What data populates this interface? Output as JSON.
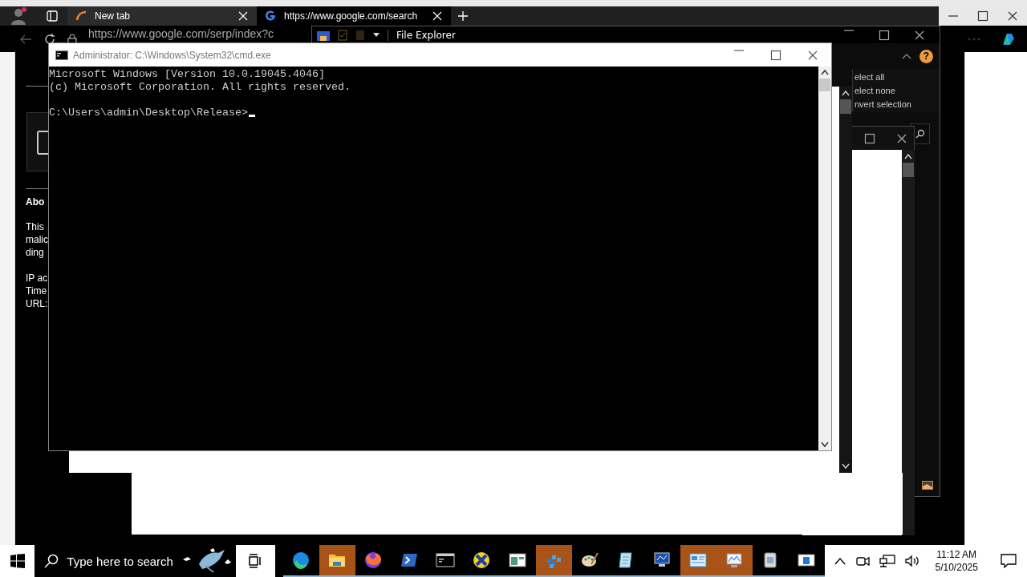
{
  "browser": {
    "tabs": [
      {
        "label": "New tab",
        "selected": false
      },
      {
        "label": "https://www.google.com/search",
        "selected": true
      }
    ],
    "address": "https://www.google.com/serp/index?c",
    "page_heading": "Abo",
    "page_paragraph": [
      "This",
      "malic",
      "ding"
    ],
    "page_details": [
      "IP ac",
      "Time",
      "URL:"
    ]
  },
  "file_explorer": {
    "title": "File Explorer",
    "ribbon_items": [
      "elect all",
      "elect none",
      "nvert selection"
    ],
    "help": "?"
  },
  "cmd": {
    "title": "Administrator: C:\\Windows\\System32\\cmd.exe",
    "output": [
      "Microsoft Windows [Version 10.0.19045.4046]",
      "(c) Microsoft Corporation. All rights reserved."
    ],
    "prompt": "C:\\Users\\admin\\Desktop\\Release>"
  },
  "taskbar": {
    "search": {
      "placeholder": "Type here to search"
    },
    "apps": [
      {
        "kind": "edge",
        "active": false
      },
      {
        "kind": "folder",
        "active": true
      },
      {
        "kind": "fox",
        "active": false
      },
      {
        "kind": "terminal",
        "active": false
      },
      {
        "kind": "console",
        "active": false
      },
      {
        "kind": "xcircle",
        "active": false
      },
      {
        "kind": "window",
        "active": false
      },
      {
        "kind": "cubes",
        "active": true
      },
      {
        "kind": "palette",
        "active": false
      },
      {
        "kind": "notepad",
        "active": false
      },
      {
        "kind": "monitor",
        "active": false
      },
      {
        "kind": "dashboard",
        "active": true
      },
      {
        "kind": "chartmonitor",
        "active": true
      },
      {
        "kind": "package",
        "active": false
      },
      {
        "kind": "appwindow",
        "active": false
      }
    ],
    "time": "11:12 AM",
    "date": "5/10/2025"
  }
}
